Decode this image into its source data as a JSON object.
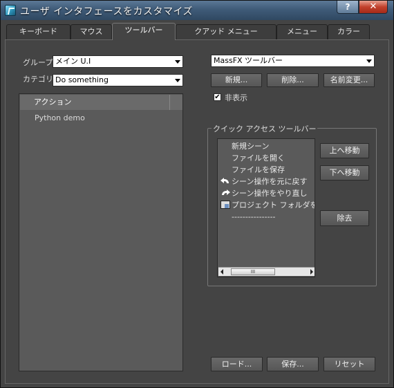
{
  "window": {
    "title": "ユーザ インタフェースをカスタマイズ",
    "help_label": "?",
    "close_label": "✕"
  },
  "tabs": [
    {
      "label": "キーボード"
    },
    {
      "label": "マウス"
    },
    {
      "label": "ツールバー",
      "active": true
    },
    {
      "label": "クアッド メニュー"
    },
    {
      "label": "メニュー"
    },
    {
      "label": "カラー"
    }
  ],
  "left": {
    "group_label": "グループ:",
    "group_value": "メイン U.I",
    "category_label": "カテゴリ:",
    "category_value": "Do something",
    "list_header": "アクション",
    "items": [
      "Python demo"
    ]
  },
  "right": {
    "toolbar_select_value": "MassFX ツールバー",
    "new_label": "新規...",
    "delete_label": "削除...",
    "rename_label": "名前変更...",
    "hide_label": "非表示",
    "hide_checked": true,
    "quick_access_title": "クイック アクセス ツールバー",
    "quick_access_items": [
      {
        "label": "新規シーン",
        "icon": ""
      },
      {
        "label": "ファイルを開く",
        "icon": ""
      },
      {
        "label": "ファイルを保存",
        "icon": ""
      },
      {
        "label": "シーン操作を元に戻す",
        "icon": "undo-icon"
      },
      {
        "label": "シーン操作をやり直し",
        "icon": "redo-icon"
      },
      {
        "label": "プロジェクト フォルダを設定",
        "icon": "project-folder-icon"
      },
      {
        "label": "----------------",
        "icon": ""
      }
    ],
    "move_up_label": "上へ移動",
    "move_down_label": "下へ移動",
    "remove_label": "除去",
    "scroll_thumb_label": "III"
  },
  "footer": {
    "load_label": "ロード...",
    "save_label": "保存...",
    "reset_label": "リセット"
  }
}
